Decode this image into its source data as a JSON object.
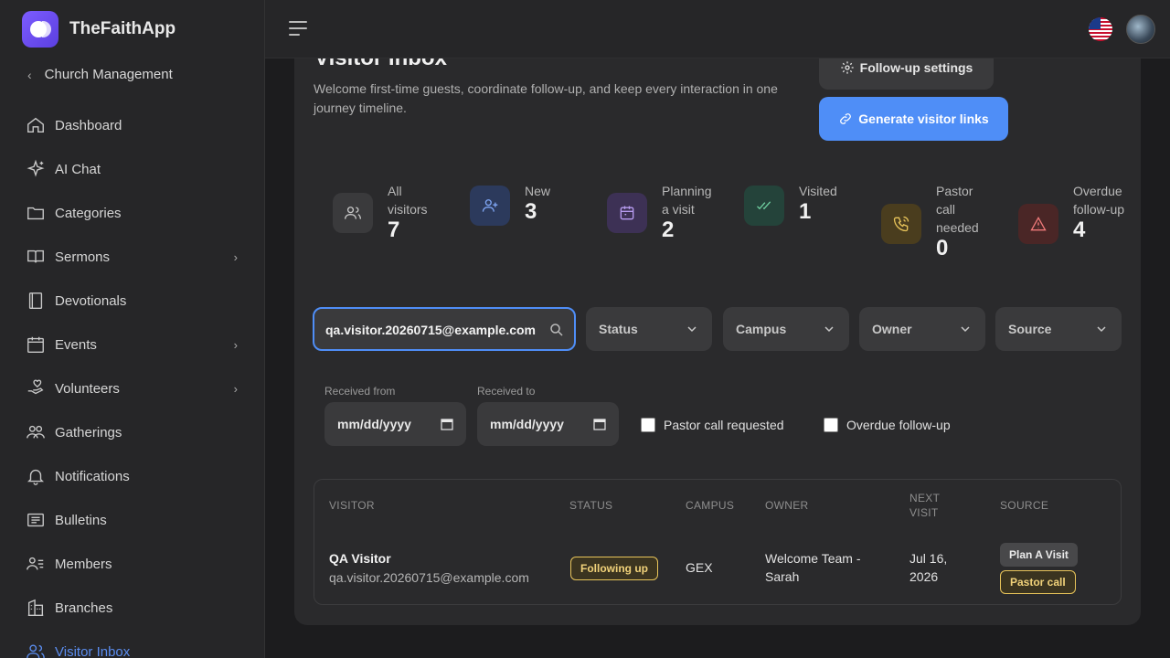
{
  "app": {
    "name": "TheFaithApp"
  },
  "sidebar": {
    "back_label": "Church Management",
    "items": [
      {
        "label": "Dashboard",
        "icon": "home-icon"
      },
      {
        "label": "AI Chat",
        "icon": "sparkle-icon"
      },
      {
        "label": "Categories",
        "icon": "folder-icon"
      },
      {
        "label": "Sermons",
        "icon": "book-icon",
        "has_children": true
      },
      {
        "label": "Devotionals",
        "icon": "notebook-icon"
      },
      {
        "label": "Events",
        "icon": "calendar-icon",
        "has_children": true
      },
      {
        "label": "Volunteers",
        "icon": "hand-heart-icon",
        "has_children": true
      },
      {
        "label": "Gatherings",
        "icon": "group-icon"
      },
      {
        "label": "Notifications",
        "icon": "bell-icon"
      },
      {
        "label": "Bulletins",
        "icon": "bulletin-icon"
      },
      {
        "label": "Members",
        "icon": "members-icon"
      },
      {
        "label": "Branches",
        "icon": "building-icon"
      },
      {
        "label": "Visitor Inbox",
        "icon": "users-icon",
        "active": true
      }
    ]
  },
  "page": {
    "title": "Visitor Inbox",
    "subtitle": "Welcome first-time guests, coordinate follow-up, and keep every interaction in one journey timeline.",
    "settings_label": "Follow-up settings",
    "generate_label": "Generate visitor links"
  },
  "stats": [
    {
      "label": "All visitors",
      "value": "7",
      "color": "#c8c8c8"
    },
    {
      "label": "New",
      "value": "3",
      "color": "#7fa6f5"
    },
    {
      "label": "Planning a visit",
      "value": "2",
      "color": "#b79cf0"
    },
    {
      "label": "Visited",
      "value": "1",
      "color": "#6fd0a0"
    },
    {
      "label": "Pastor call needed",
      "value": "0",
      "color": "#e8c45a"
    },
    {
      "label": "Overdue follow-up",
      "value": "4",
      "color": "#f07a7a"
    }
  ],
  "filters": {
    "search_value": "qa.visitor.20260715@example.com",
    "status": "Status",
    "campus": "Campus",
    "owner": "Owner",
    "source": "Source",
    "received_from_label": "Received from",
    "received_to_label": "Received to",
    "date_placeholder": "mm/dd/yyyy",
    "pastor_call_label": "Pastor call requested",
    "overdue_label": "Overdue follow-up"
  },
  "table": {
    "headers": [
      "VISITOR",
      "STATUS",
      "CAMPUS",
      "OWNER",
      "NEXT VISIT",
      "SOURCE"
    ],
    "rows": [
      {
        "name": "QA Visitor",
        "email": "qa.visitor.20260715@example.com",
        "status": "Following up",
        "campus": "GEX",
        "owner": "Welcome Team - Sarah",
        "next_visit": "Jul 16, 2026",
        "sources": [
          "Plan A Visit",
          "Pastor call"
        ]
      }
    ]
  }
}
